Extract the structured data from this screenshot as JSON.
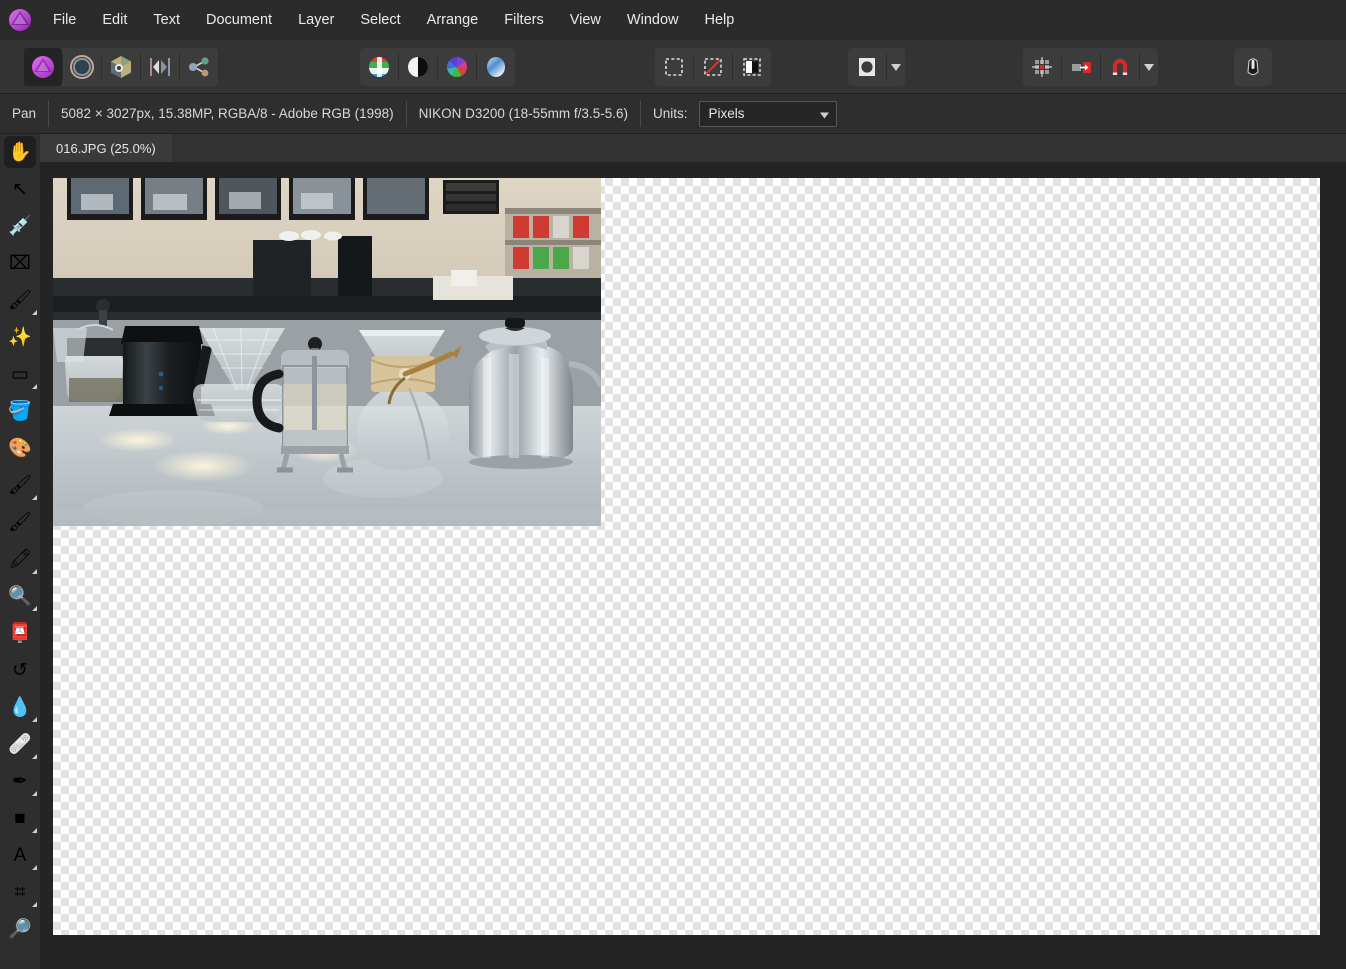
{
  "app": {
    "name": "Affinity Photo",
    "logo_icon": "affinity-photo-logo"
  },
  "menubar": {
    "items": [
      {
        "label": "File",
        "name": "menu-file"
      },
      {
        "label": "Edit",
        "name": "menu-edit"
      },
      {
        "label": "Text",
        "name": "menu-text"
      },
      {
        "label": "Document",
        "name": "menu-document"
      },
      {
        "label": "Layer",
        "name": "menu-layer"
      },
      {
        "label": "Select",
        "name": "menu-select"
      },
      {
        "label": "Arrange",
        "name": "menu-arrange"
      },
      {
        "label": "Filters",
        "name": "menu-filters"
      },
      {
        "label": "View",
        "name": "menu-view"
      },
      {
        "label": "Window",
        "name": "menu-window"
      },
      {
        "label": "Help",
        "name": "menu-help"
      }
    ]
  },
  "toolbar": {
    "personas": [
      {
        "name": "persona-photo",
        "icon": "aperture-icon",
        "selected": true
      },
      {
        "name": "persona-liquify",
        "icon": "ring-icon",
        "selected": false
      },
      {
        "name": "persona-develop",
        "icon": "hexagon-icon",
        "selected": false
      },
      {
        "name": "persona-tone-mapping",
        "icon": "mirror-icon",
        "selected": false
      },
      {
        "name": "persona-export",
        "icon": "share-nodes-icon",
        "selected": false
      }
    ],
    "adjustments": [
      {
        "name": "channels-button",
        "icon": "color-channels-icon"
      },
      {
        "name": "contrast-button",
        "icon": "black-white-circle-icon"
      },
      {
        "name": "color-wheel-button",
        "icon": "color-wheel-icon"
      },
      {
        "name": "gradient-button",
        "icon": "gradient-sphere-icon"
      }
    ],
    "selection": [
      {
        "name": "select-all-button",
        "icon": "marquee-dashed-icon"
      },
      {
        "name": "deselect-button",
        "icon": "marquee-slash-icon"
      },
      {
        "name": "refine-selection-button",
        "icon": "refine-edges-icon"
      }
    ],
    "mask": {
      "name": "mask-button",
      "icon": "mask-ellipse-icon",
      "dropdown_icon": "chevron-down-icon"
    },
    "snapping": [
      {
        "name": "grid-button",
        "icon": "grid-icon"
      },
      {
        "name": "move-to-edge-button",
        "icon": "arrow-to-edge-icon"
      },
      {
        "name": "snapping-button",
        "icon": "magnet-icon"
      }
    ],
    "snapping_dropdown_icon": "chevron-down-icon",
    "right": {
      "name": "pressure-button",
      "icon": "mouse-pressure-icon"
    }
  },
  "context_bar": {
    "tool_name": "Pan",
    "document_info": "5082 × 3027px, 15.38MP, RGBA/8 - Adobe RGB (1998)",
    "camera_info": "NIKON D3200 (18-55mm f/3.5-5.6)",
    "units_label": "Units:",
    "units_value": "Pixels",
    "units_chevron_icon": "chevron-down-icon"
  },
  "document": {
    "tab_label": "016.JPG (25.0%)",
    "zoom_percent": "25.0%",
    "file_name": "016.JPG"
  },
  "tools": [
    {
      "name": "tool-pan",
      "label": "Pan",
      "icon": "hand-icon",
      "glyph": "✋",
      "active": true,
      "has_group": false
    },
    {
      "name": "tool-move",
      "label": "Move",
      "icon": "cursor-arrow-icon",
      "glyph": "↖",
      "active": false,
      "has_group": false
    },
    {
      "name": "tool-color-picker",
      "label": "Colour Picker",
      "icon": "eyedropper-icon",
      "glyph": "💉",
      "active": false,
      "has_group": false
    },
    {
      "name": "tool-crop",
      "label": "Crop",
      "icon": "crop-icon",
      "glyph": "⌧",
      "active": false,
      "has_group": false
    },
    {
      "name": "tool-selection-brush",
      "label": "Selection Brush",
      "icon": "selection-brush-icon",
      "glyph": "🖌",
      "active": false,
      "has_group": true
    },
    {
      "name": "tool-magic-wand",
      "label": "Flood Select",
      "icon": "magic-wand-icon",
      "glyph": "✨",
      "active": false,
      "has_group": false
    },
    {
      "name": "tool-marquee",
      "label": "Rectangular Marquee",
      "icon": "marquee-icon",
      "glyph": "▭",
      "active": false,
      "has_group": true
    },
    {
      "name": "tool-flood-fill",
      "label": "Flood Fill",
      "icon": "paint-bucket-icon",
      "glyph": "🪣",
      "active": false,
      "has_group": false
    },
    {
      "name": "tool-colour-replacement",
      "label": "Colour Replacement",
      "icon": "color-wheel-brush-icon",
      "glyph": "🎨",
      "active": false,
      "has_group": false
    },
    {
      "name": "tool-paint-brush",
      "label": "Paint Brush",
      "icon": "paintbrush-icon",
      "glyph": "🖌",
      "active": false,
      "has_group": true
    },
    {
      "name": "tool-paint-mixer",
      "label": "Paint Mixer Brush",
      "icon": "paint-mixer-icon",
      "glyph": "🖌",
      "active": false,
      "has_group": false
    },
    {
      "name": "tool-erase",
      "label": "Erase Brush",
      "icon": "eraser-icon",
      "glyph": "🖍",
      "active": false,
      "has_group": true
    },
    {
      "name": "tool-dodge",
      "label": "Dodge Brush",
      "icon": "dodge-icon",
      "glyph": "🔍",
      "active": false,
      "has_group": true
    },
    {
      "name": "tool-clone",
      "label": "Clone Brush",
      "icon": "clone-stamp-icon",
      "glyph": "📮",
      "active": false,
      "has_group": false
    },
    {
      "name": "tool-undo-brush",
      "label": "Undo Brush",
      "icon": "undo-brush-icon",
      "glyph": "↺",
      "active": false,
      "has_group": false
    },
    {
      "name": "tool-blur",
      "label": "Blur Brush",
      "icon": "water-droplet-icon",
      "glyph": "💧",
      "active": false,
      "has_group": true
    },
    {
      "name": "tool-healing",
      "label": "Healing Brush",
      "icon": "bandage-icon",
      "glyph": "🩹",
      "active": false,
      "has_group": true
    },
    {
      "name": "tool-pen",
      "label": "Pen",
      "icon": "pen-nib-icon",
      "glyph": "✒",
      "active": false,
      "has_group": true
    },
    {
      "name": "tool-rectangle",
      "label": "Rectangle",
      "icon": "blue-square-icon",
      "glyph": "■",
      "active": false,
      "has_group": true
    },
    {
      "name": "tool-text",
      "label": "Artistic Text",
      "icon": "text-a-icon",
      "glyph": "A",
      "active": false,
      "has_group": true
    },
    {
      "name": "tool-mesh-warp",
      "label": "Mesh Warp",
      "icon": "mesh-warp-icon",
      "glyph": "⌗",
      "active": false,
      "has_group": true
    },
    {
      "name": "tool-zoom",
      "label": "Zoom",
      "icon": "magnifier-icon",
      "glyph": "🔎",
      "active": false,
      "has_group": false
    }
  ],
  "canvas": {
    "transparency_checker": true,
    "image_alt": "Coffee shop counter with grinder, pour-over drippers, French press, Chemex and kettle",
    "background_color": "#242424"
  },
  "colors": {
    "menubar_bg": "#2b2b2b",
    "toolbar_bg": "#333333",
    "context_bg": "#2e2e2e",
    "panel_bg": "#2e2e2e",
    "canvas_bg": "#242424",
    "text": "#e9e9e9",
    "accent_magenta": "#c341d8",
    "accent_red": "#d02b2b",
    "selected_bg": "#1f1f1f"
  }
}
